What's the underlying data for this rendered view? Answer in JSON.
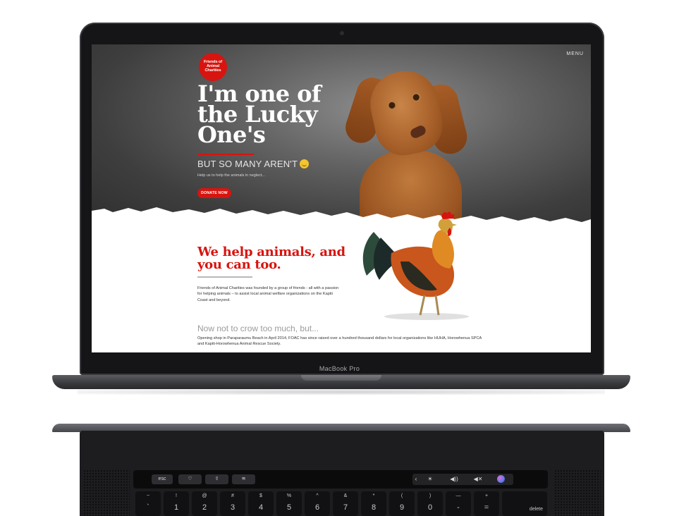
{
  "device": {
    "bezel_label": "MacBook Pro"
  },
  "website": {
    "menu_label": "MENU",
    "logo_text": "Friends of Animal Charities",
    "hero": {
      "title": "I'm one of the Lucky One's",
      "subtitle": "BUT SO MANY AREN'T",
      "tagline": "Help us to help the animals in neglect...",
      "donate_label": "DONATE NOW"
    },
    "about": {
      "heading": "We help animals, and you can too.",
      "paragraph": "Friends of Animal Charities was founded by a group of friends - all with a passion for helping animals – to assist local animal welfare organizations on the Kapiti Coast and beyond."
    },
    "achievements": {
      "heading": "Now not to crow too much, but...",
      "paragraph": "Opening shop in Paraparaumu Beach in April 2014, FOAC has since raised over a hundred thousand dollars for local organizations like HUHA, Horowhenua SPCA and Kapiti-Horowhenua Animal Rescue Society."
    }
  },
  "touchbar": {
    "esc": "esc",
    "heart_icon": "♡",
    "share_icon": "⇪",
    "sliders_icon": "≋",
    "collapse": "‹",
    "brightness": "☀",
    "volume": "◀))",
    "mute": "◀✕"
  },
  "keyboard": {
    "keys": [
      {
        "top": "~",
        "bottom": "`"
      },
      {
        "top": "!",
        "bottom": "1"
      },
      {
        "top": "@",
        "bottom": "2"
      },
      {
        "top": "#",
        "bottom": "3"
      },
      {
        "top": "$",
        "bottom": "4"
      },
      {
        "top": "%",
        "bottom": "5"
      },
      {
        "top": "^",
        "bottom": "6"
      },
      {
        "top": "&",
        "bottom": "7"
      },
      {
        "top": "*",
        "bottom": "8"
      },
      {
        "top": "(",
        "bottom": "9"
      },
      {
        "top": ")",
        "bottom": "0"
      },
      {
        "top": "—",
        "bottom": "-"
      },
      {
        "top": "+",
        "bottom": "="
      }
    ],
    "delete_label": "delete"
  }
}
